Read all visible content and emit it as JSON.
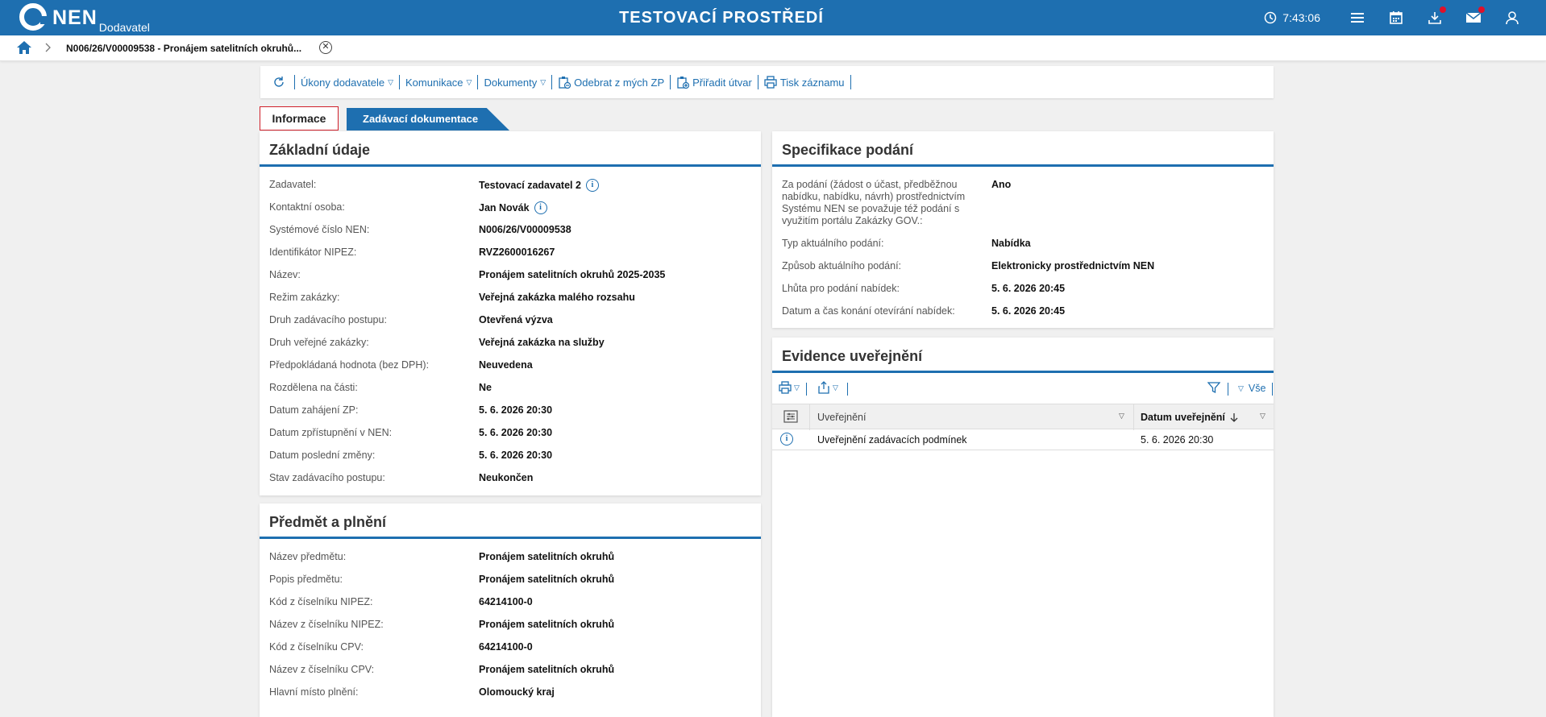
{
  "header": {
    "logo_text": "NEN",
    "logo_sub": "Dodavatel",
    "environment": "TESTOVACÍ PROSTŘEDÍ",
    "time": "7:43:06",
    "icons": [
      "clock-icon",
      "menu-icon",
      "calendar-icon",
      "download-icon",
      "mail-icon",
      "user-icon"
    ],
    "brand_color": "#1e6fb0",
    "notification_color": "#e0102a"
  },
  "breadcrumb": {
    "title": "N006/26/V00009538 - Pronájem satelitních okruhů..."
  },
  "toolbar": {
    "actions": [
      "Úkony dodavatele",
      "Komunikace",
      "Dokumenty",
      "Odebrat z mých ZP",
      "Přiřadit útvar",
      "Tisk záznamu"
    ]
  },
  "tabs": {
    "info": "Informace",
    "docs": "Zadávací dokumentace"
  },
  "zakladni": {
    "title": "Základní údaje",
    "rows": [
      {
        "label": "Zadavatel:",
        "value": "Testovací zadavatel 2"
      },
      {
        "label": "Kontaktní osoba:",
        "value": "Jan Novák"
      },
      {
        "label": "Systémové číslo NEN:",
        "value": "N006/26/V00009538"
      },
      {
        "label": "Identifikátor NIPEZ:",
        "value": "RVZ2600016267"
      },
      {
        "label": "Název:",
        "value": "Pronájem satelitních okruhů 2025-2035"
      },
      {
        "label": "Režim zakázky:",
        "value": "Veřejná zakázka malého rozsahu"
      },
      {
        "label": "Druh zadávacího postupu:",
        "value": "Otevřená výzva"
      },
      {
        "label": "Druh veřejné zakázky:",
        "value": "Veřejná zakázka na služby"
      },
      {
        "label": "Předpokládaná hodnota (bez DPH):",
        "value": "Neuvedena"
      },
      {
        "label": "Rozdělena na části:",
        "value": "Ne"
      },
      {
        "label": "Datum zahájení ZP:",
        "value": "5. 6. 2026 20:30"
      },
      {
        "label": "Datum zpřístupnění v NEN:",
        "value": "5. 6. 2026 20:30"
      },
      {
        "label": "Datum poslední změny:",
        "value": "5. 6. 2026 20:30"
      },
      {
        "label": "Stav zadávacího postupu:",
        "value": "Neukončen"
      }
    ]
  },
  "predmet": {
    "title": "Předmět a plnění",
    "rows": [
      {
        "label": "Název předmětu:",
        "value": "Pronájem satelitních okruhů"
      },
      {
        "label": "Popis předmětu:",
        "value": "Pronájem satelitních okruhů"
      },
      {
        "label": "Kód z číselníku NIPEZ:",
        "value": "64214100-0"
      },
      {
        "label": "Název z číselníku NIPEZ:",
        "value": "Pronájem satelitních okruhů"
      },
      {
        "label": "Kód z číselníku CPV:",
        "value": "64214100-0"
      },
      {
        "label": "Název z číselníku CPV:",
        "value": "Pronájem satelitních okruhů"
      },
      {
        "label": "Hlavní místo plnění:",
        "value": "Olomoucký kraj"
      }
    ]
  },
  "specifikace": {
    "title": "Specifikace podání",
    "rows": [
      {
        "label": "Za podání (žádost o účast, předběžnou nabídku, nabídku, návrh) prostřednictvím Systému NEN se považuje též podání s využitím portálu Zakázky GOV.:",
        "value": "Ano"
      },
      {
        "label": "Typ aktuálního podání:",
        "value": "Nabídka"
      },
      {
        "label": "Způsob aktuálního podání:",
        "value": "Elektronicky prostřednictvím NEN"
      },
      {
        "label": "Lhůta pro podání nabídek:",
        "value": "5. 6. 2026 20:45"
      },
      {
        "label": "Datum a čas konání otevírání nabídek:",
        "value": "5. 6. 2026 20:45"
      }
    ]
  },
  "evidence": {
    "title": "Evidence uveřejnění",
    "filter_all": "Vše",
    "columns": [
      "Uveřejnění",
      "Datum uveřejnění"
    ],
    "rows": [
      {
        "uverejneni": "Uveřejnění zadávacích podmínek",
        "datum": "5. 6. 2026 20:30"
      }
    ]
  }
}
